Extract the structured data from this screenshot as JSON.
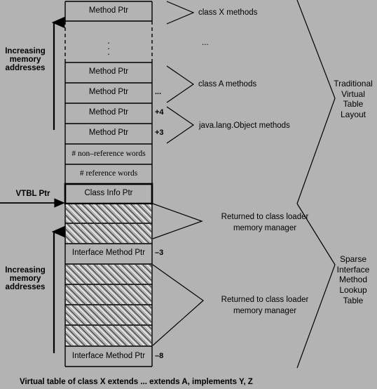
{
  "diagram": {
    "caption": "Virtual table of class X extends ... extends A, implements Y, Z",
    "background_color": "#b3b3b3",
    "line_color": "#000000"
  },
  "left_labels": {
    "increasing_top": "Increasing\nmemory\naddresses",
    "increasing_bottom": "Increasing\nmemory\naddresses",
    "vtbl_ptr": "VTBL Ptr"
  },
  "table": {
    "rows": [
      {
        "label": "Method Ptr",
        "kind": "cell",
        "offset": ""
      },
      {
        "label": "",
        "kind": "ellipsis",
        "offset": ""
      },
      {
        "label": "Method Ptr",
        "kind": "cell",
        "offset": ""
      },
      {
        "label": "Method Ptr",
        "kind": "cell",
        "offset": "..."
      },
      {
        "label": "Method Ptr",
        "kind": "cell",
        "offset": "+4"
      },
      {
        "label": "Method Ptr",
        "kind": "cell",
        "offset": "+3"
      },
      {
        "label": "# non–reference words",
        "kind": "cell-serif",
        "offset": ""
      },
      {
        "label": "# reference words",
        "kind": "cell-serif",
        "offset": ""
      },
      {
        "label": "Class Info Ptr",
        "kind": "cell-bold",
        "offset": ""
      },
      {
        "label": "",
        "kind": "hatched",
        "offset": ""
      },
      {
        "label": "",
        "kind": "hatched",
        "offset": ""
      },
      {
        "label": "Interface Method Ptr",
        "kind": "cell",
        "offset": "–3"
      },
      {
        "label": "",
        "kind": "hatched",
        "offset": ""
      },
      {
        "label": "",
        "kind": "hatched",
        "offset": ""
      },
      {
        "label": "",
        "kind": "hatched",
        "offset": ""
      },
      {
        "label": "",
        "kind": "hatched",
        "offset": ""
      },
      {
        "label": "Interface Method Ptr",
        "kind": "cell",
        "offset": "–8"
      }
    ],
    "vertical_ellipsis": "."
  },
  "annotations": {
    "class_x_methods": "class X methods",
    "middle_ellipsis": "...",
    "class_a_methods": "class A methods",
    "object_methods": "java.lang.Object methods",
    "returned_top": "Returned to class loader\nmemory manager",
    "returned_bottom": "Returned to class loader\nmemory manager"
  },
  "right_labels": {
    "traditional": "Traditional\nVirtual\nTable\nLayout",
    "sparse": "Sparse\nInterface\nMethod\nLookup\nTable"
  }
}
